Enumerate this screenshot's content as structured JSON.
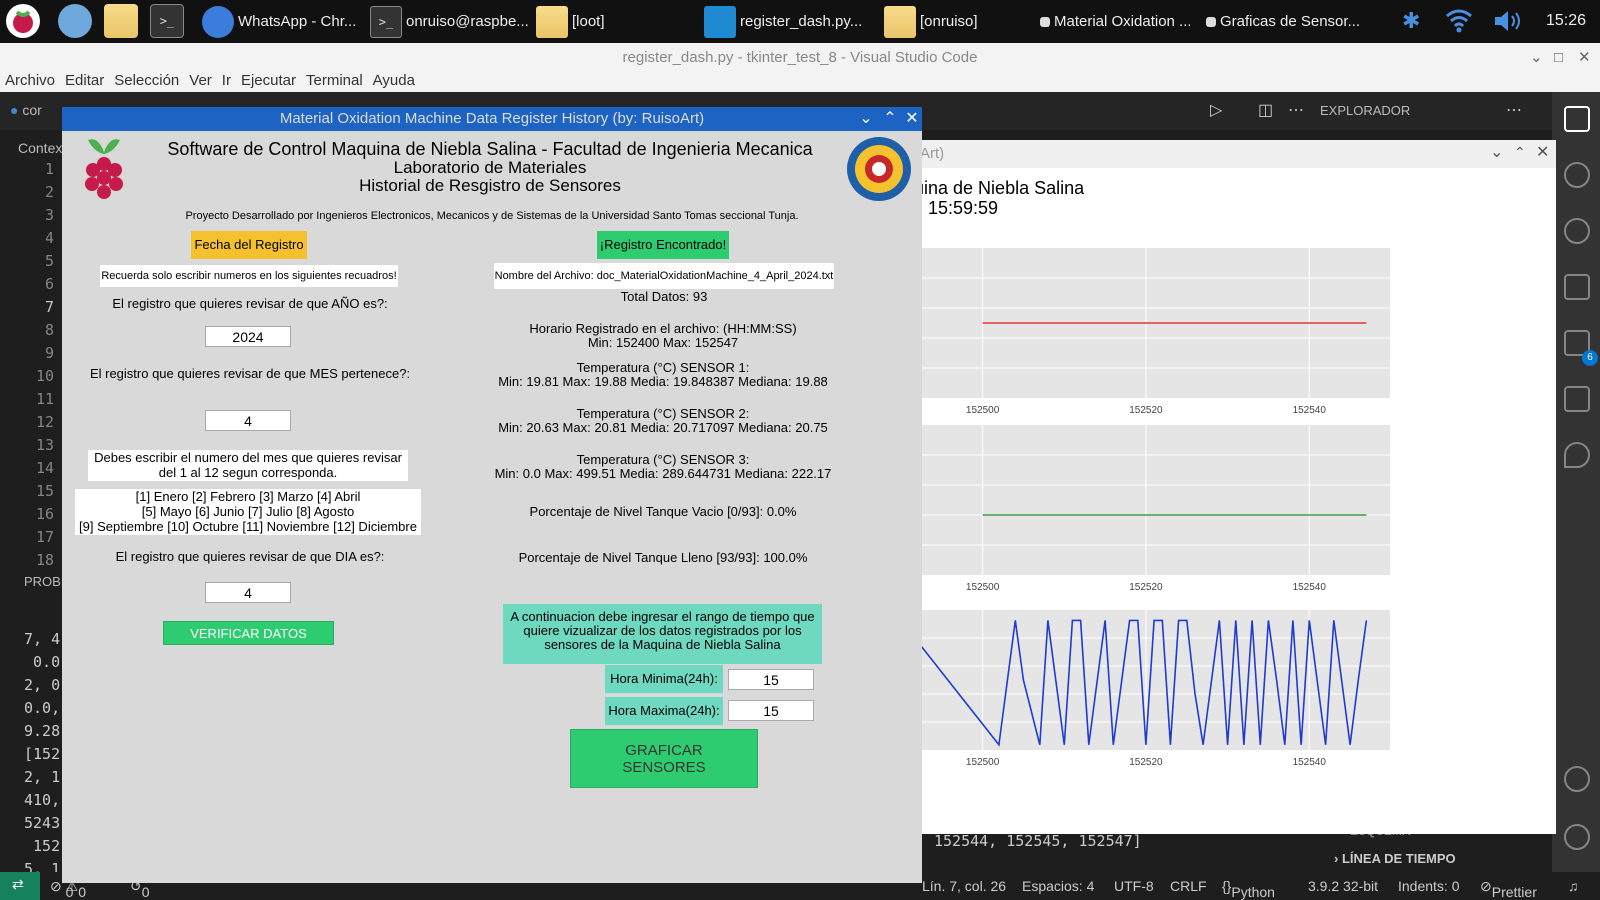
{
  "taskbar": {
    "tasks": [
      "WhatsApp - Chr...",
      "onruiso@raspbe...",
      "[loot]",
      "register_dash.py...",
      "[onruiso]",
      "Material Oxidation ...",
      "Graficas de Sensor..."
    ],
    "clock": "15:26"
  },
  "vscode": {
    "title": "register_dash.py - tkinter_test_8 - Visual Studio Code",
    "menu": [
      "Archivo",
      "Editar",
      "Selección",
      "Ver",
      "Ir",
      "Ejecutar",
      "Terminal",
      "Ayuda"
    ],
    "explorer": "EXPLORADOR",
    "tab_partial": "cor",
    "context_partial": "Contex",
    "line_numbers": [
      "1",
      "2",
      "3",
      "4",
      "5",
      "6",
      "7",
      "8",
      "9",
      "10",
      "11",
      "12",
      "13",
      "14",
      "15",
      "16",
      "17",
      "18"
    ],
    "panel_tab": "PROBL",
    "terminal_lines": [
      "7, 4",
      " 0.0",
      "2, 0",
      "0.0,",
      "9.28",
      "[152",
      "2, 1",
      "410,",
      "5243",
      " 152",
      "5, 1"
    ],
    "terminal_tail": "152544, 152545, 152547]",
    "outline": [
      "ESQUEMA",
      "LÍNEA DE TIEMPO"
    ],
    "badge": "6",
    "status": {
      "errors": "0",
      "warnings": "0",
      "ports": "0",
      "position": "Lín. 7, col. 26",
      "spaces": "Espacios: 4",
      "encoding": "UTF-8",
      "eol": "CRLF",
      "language": "Python",
      "interpreter": "3.9.2 32-bit",
      "indents": "Indents: 0",
      "formatter": "Prettier"
    }
  },
  "plot_window": {
    "title_partial": "Art)",
    "heading_line1": "uina de Niebla Salina",
    "heading_line2": "l: 15:59:59"
  },
  "chart_data": [
    {
      "type": "line",
      "x": [
        152500,
        152547
      ],
      "series": [
        {
          "values": [
            19.85,
            19.85
          ],
          "color": "#e53935"
        }
      ],
      "xticks": [
        "152500",
        "152520",
        "152540"
      ]
    },
    {
      "type": "line",
      "x": [
        152500,
        152547
      ],
      "series": [
        {
          "values": [
            20.7,
            20.7
          ],
          "color": "#43a047"
        }
      ],
      "xticks": [
        "152500",
        "152520",
        "152540"
      ]
    },
    {
      "type": "line",
      "series": [
        {
          "color": "#1e3ccf",
          "points": [
            [
              152490,
              480
            ],
            [
              152502,
              0
            ],
            [
              152504,
              480
            ],
            [
              152505,
              250
            ],
            [
              152507,
              0
            ],
            [
              152508,
              480
            ],
            [
              152510,
              0
            ],
            [
              152511,
              480
            ],
            [
              152512,
              480
            ],
            [
              152513,
              0
            ],
            [
              152515,
              480
            ],
            [
              152516,
              0
            ],
            [
              152518,
              480
            ],
            [
              152519,
              480
            ],
            [
              152520,
              0
            ],
            [
              152521,
              480
            ],
            [
              152522,
              480
            ],
            [
              152523,
              0
            ],
            [
              152524,
              480
            ],
            [
              152525,
              480
            ],
            [
              152526,
              200
            ],
            [
              152527,
              0
            ],
            [
              152529,
              480
            ],
            [
              152530,
              0
            ],
            [
              152531,
              480
            ],
            [
              152532,
              0
            ],
            [
              152533,
              480
            ],
            [
              152534,
              0
            ],
            [
              152535,
              480
            ],
            [
              152536,
              250
            ],
            [
              152537,
              0
            ],
            [
              152538,
              480
            ],
            [
              152539,
              0
            ],
            [
              152540,
              480
            ],
            [
              152542,
              0
            ],
            [
              152543,
              480
            ],
            [
              152545,
              0
            ],
            [
              152546,
              250
            ],
            [
              152547,
              480
            ]
          ]
        }
      ],
      "xticks": [
        "152500",
        "152520",
        "152540"
      ]
    }
  ],
  "app": {
    "window_title": "Material Oxidation Machine Data Register History (by: RuisoArt)",
    "header_line1": "Software de Control Maquina de Niebla Salina - Facultad de Ingenieria Mecanica",
    "header_line2": "Laboratorio de Materiales",
    "header_line3": "Historial de Resgistro de Sensores",
    "credits": "Proyecto Desarrollado por Ingenieros Electronicos, Mecanicos y de Sistemas de la Universidad Santo Tomas seccional Tunja.",
    "left": {
      "date_label": "Fecha del Registro",
      "reminder": "Recuerda solo escribir numeros en los siguientes recuadros!",
      "year_q": "El registro que quieres revisar de que AÑO es?:",
      "year_value": "2024",
      "month_q": "El registro que quieres revisar de que MES pertenece?:",
      "month_value": "4",
      "month_hint1": "Debes escribir el numero del mes que quieres revisar",
      "month_hint2": "del 1 al 12 segun corresponda.",
      "months1": "[1] Enero [2] Febrero [3] Marzo [4] Abril",
      "months2": "[5] Mayo [6] Junio [7] Julio [8] Agosto",
      "months3": "[9] Septiembre [10] Octubre [11] Noviembre [12] Diciembre",
      "day_q": "El registro que quieres revisar de que DIA es?:",
      "day_value": "4",
      "verify_button": "VERIFICAR DATOS"
    },
    "right": {
      "found": "¡Registro Encontrado!",
      "filename": "Nombre del Archivo: doc_MaterialOxidationMachine_4_April_2024.txt",
      "total": "Total Datos:    93",
      "schedule_title": "Horario Registrado en el archivo: (HH:MM:SS)",
      "schedule_values": "Min:    152400  Max:    152547",
      "s1_title": "Temperatura (°C) SENSOR 1:",
      "s1_values": "Min:   19.81  Max:   19.88  Media:   19.848387  Mediana:   19.88",
      "s2_title": "Temperatura (°C) SENSOR 2:",
      "s2_values": "Min:   20.63  Max:   20.81  Media:   20.717097  Mediana:   20.75",
      "s3_title": "Temperatura (°C) SENSOR 3:",
      "s3_values": "Min:   0.0  Max:   499.51  Media:   289.644731  Mediana:   222.17",
      "tank_empty": "Porcentaje de Nivel Tanque Vacio [0/93]: 0.0%",
      "tank_full": "Porcentaje de Nivel Tanque Lleno [93/93]: 100.0%",
      "range_info1": "A continuacion debe ingresar el rango de tiempo que",
      "range_info2": "quiere vizualizar de los datos registrados por los",
      "range_info3": "sensores de la Maquina de Niebla Salina",
      "hour_min_label": "Hora Minima(24h):",
      "hour_min_value": "15",
      "hour_max_label": "Hora Maxima(24h):",
      "hour_max_value": "15",
      "graph_button_line1": "GRAFICAR",
      "graph_button_line2": "SENSORES"
    }
  },
  "colors": {
    "accent_yellow": "#f6c12e",
    "accent_green": "#2ecc71",
    "teal": "#6fd9bf",
    "titlebar_blue": "#1c63c4"
  }
}
